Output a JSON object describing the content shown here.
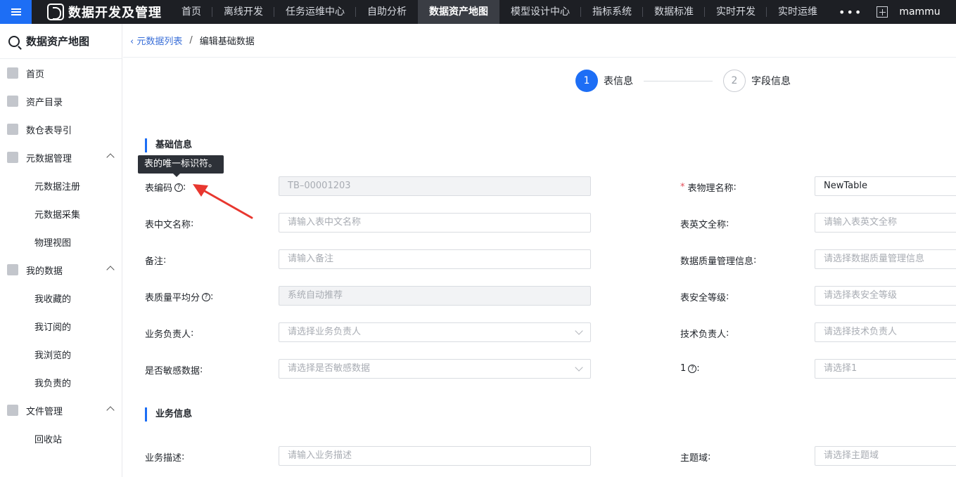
{
  "topbar": {
    "app_title": "数据开发及管理",
    "nav": [
      "首页",
      "离线开发",
      "任务运维中心",
      "自助分析",
      "数据资产地图",
      "模型设计中心",
      "指标系统",
      "数据标准",
      "实时开发",
      "实时运维"
    ],
    "active_nav": "数据资产地图",
    "more": "•••",
    "user": "mammu"
  },
  "sidebar": {
    "title": "数据资产地图",
    "items": [
      {
        "label": "首页",
        "icon": "home-icon"
      },
      {
        "label": "资产目录",
        "icon": "catalog-icon"
      },
      {
        "label": "数仓表导引",
        "icon": "warehouse-icon"
      },
      {
        "label": "元数据管理",
        "icon": "grid-icon",
        "expanded": true,
        "children": [
          "元数据注册",
          "元数据采集",
          "物理视图"
        ]
      },
      {
        "label": "我的数据",
        "icon": "user-icon",
        "expanded": true,
        "children": [
          "我收藏的",
          "我订阅的",
          "我浏览的",
          "我负责的"
        ]
      },
      {
        "label": "文件管理",
        "icon": "folder-icon",
        "expanded": true,
        "children": [
          "回收站"
        ]
      }
    ]
  },
  "breadcrumb": {
    "back": "元数据列表",
    "separator": "/",
    "current": "编辑基础数据"
  },
  "steps": [
    {
      "num": "1",
      "label": "表信息",
      "active": true
    },
    {
      "num": "2",
      "label": "字段信息",
      "active": false
    }
  ],
  "tooltip": "表的唯一标识符。",
  "sections": {
    "basic": "基础信息",
    "business": "业务信息"
  },
  "form": {
    "code_label": "表编码",
    "code_value": "TB–00001203",
    "phys_name_label": "表物理名称",
    "phys_name_value": "NewTable",
    "cn_name_label": "表中文名称",
    "cn_name_ph": "请输入表中文名称",
    "en_name_label": "表英文全称",
    "en_name_ph": "请输入表英文全称",
    "remark_label": "备注",
    "remark_ph": "请输入备注",
    "quality_info_label": "数据质量管理信息",
    "quality_info_ph": "请选择数据质量管理信息",
    "quality_score_label": "表质量平均分",
    "quality_score_ph": "系统自动推荐",
    "security_label": "表安全等级",
    "security_ph": "请选择表安全等级",
    "biz_owner_label": "业务负责人",
    "biz_owner_ph": "请选择业务负责人",
    "tech_owner_label": "技术负责人",
    "tech_owner_ph": "请选择技术负责人",
    "sensitive_label": "是否敏感数据",
    "sensitive_ph": "请选择是否敏感数据",
    "custom1_label": "1",
    "custom1_ph": "请选择1",
    "biz_desc_label": "业务描述",
    "biz_desc_ph": "请输入业务描述",
    "domain_label": "主题域",
    "domain_ph": "请选择主题域"
  },
  "colors": {
    "accent": "#1d6ef5",
    "topbar": "#1d1f24",
    "annotation_arrow": "#e8372f"
  }
}
